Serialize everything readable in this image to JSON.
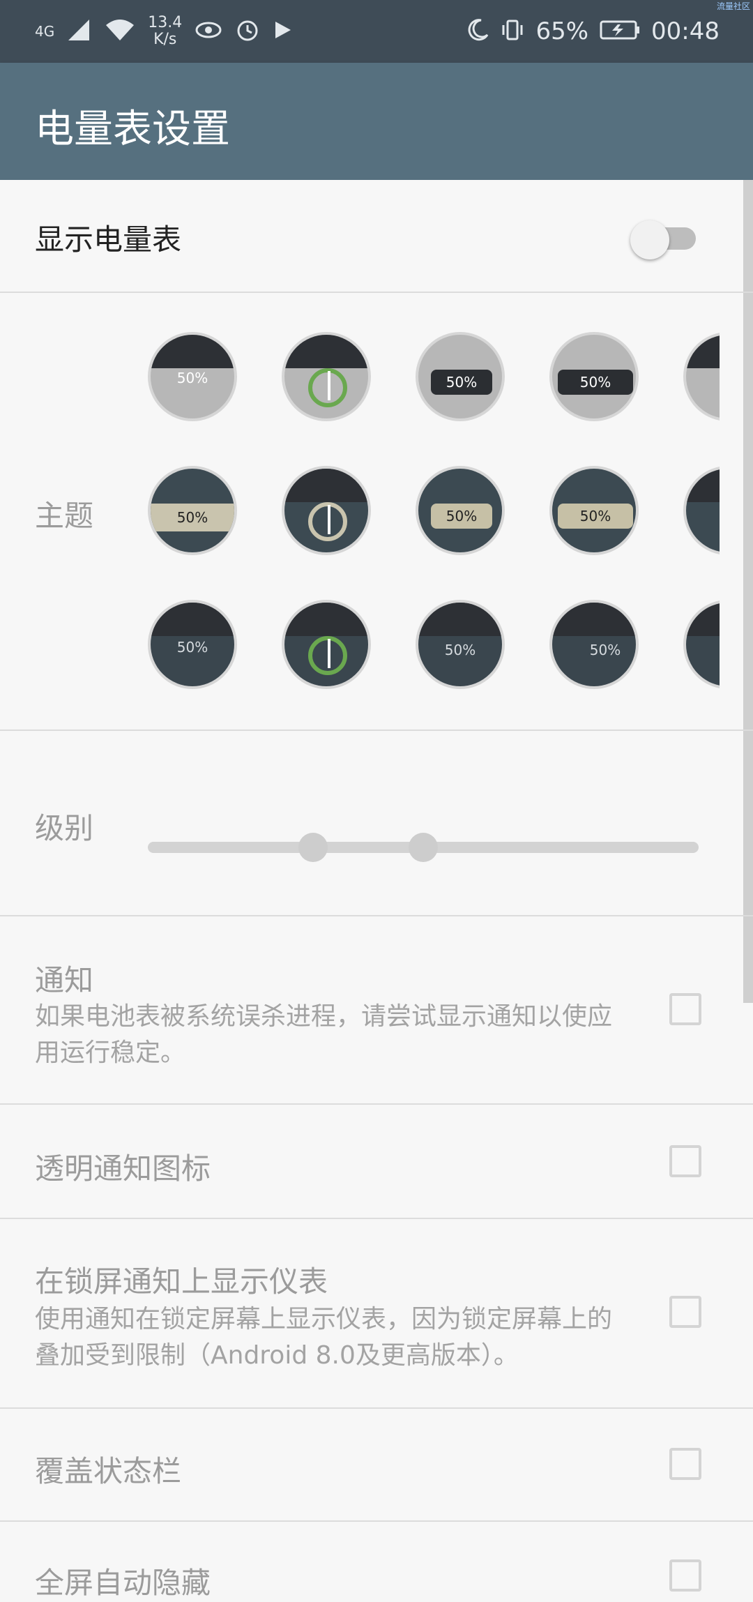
{
  "status_bar": {
    "network_type": "4G",
    "net_speed_value": "13.4",
    "net_speed_unit": "K/s",
    "battery_percent": "65%",
    "time": "00:48",
    "corner_tag": "流量社区"
  },
  "app_bar": {
    "title": "电量表设置"
  },
  "show_meter": {
    "label": "显示电量表",
    "enabled": false
  },
  "theme": {
    "label": "主题",
    "sample_text": "50%"
  },
  "level": {
    "label": "级别",
    "slider_low": 0.3,
    "slider_high": 0.5
  },
  "settings": [
    {
      "title": "通知",
      "subtitle": "如果电池表被系统误杀进程，请尝试显示通知以使应用运行稳定。",
      "checked": false
    },
    {
      "title": "透明通知图标",
      "checked": false
    },
    {
      "title": "在锁屏通知上显示仪表",
      "subtitle": "使用通知在锁定屏幕上显示仪表，因为锁定屏幕上的叠加受到限制（Android 8.0及更高版本）。",
      "checked": false
    },
    {
      "title": "覆盖状态栏",
      "checked": false
    },
    {
      "title": "全屏自动隐藏",
      "checked": false
    }
  ]
}
